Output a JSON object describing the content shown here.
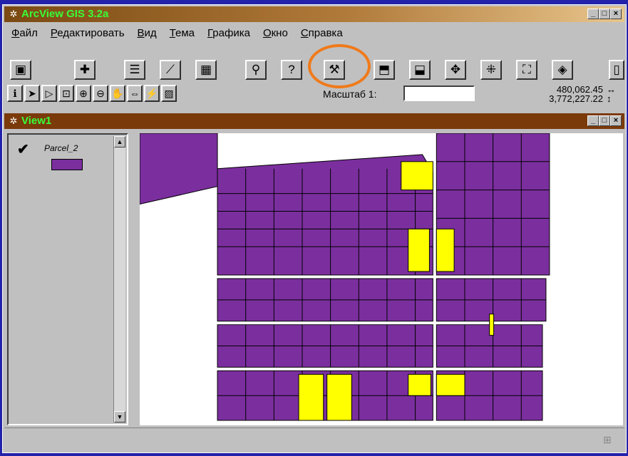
{
  "app": {
    "title": "ArcView GIS 3.2a",
    "window_controls": [
      "_",
      "□",
      "×"
    ]
  },
  "menu": [
    "Файл",
    "Редактировать",
    "Вид",
    "Тема",
    "Графика",
    "Окно",
    "Справка"
  ],
  "toolbar_icons": [
    "save-icon",
    "add-theme-icon",
    "properties-icon",
    "edit-legend-icon",
    "table-icon",
    "find-icon",
    "help-icon",
    "hotlink-icon",
    "select-feature-icon",
    "open-theme-table-icon",
    "zoom-full-icon",
    "zoom-active-icon",
    "zoom-in-fixed-icon",
    "zoom-out-fixed-icon",
    "zoom-previous-icon",
    "layout-icon"
  ],
  "tools": [
    "identify-icon",
    "pointer-icon",
    "vertex-edit-icon",
    "select-feature-tool-icon",
    "zoom-in-icon",
    "zoom-out-icon",
    "pan-icon",
    "measure-icon",
    "hotlink-tool-icon",
    "label-icon"
  ],
  "scale": {
    "label": "Масштаб 1:",
    "value": ""
  },
  "coords": {
    "x": "480,062.45",
    "y": "3,772,227.22"
  },
  "view": {
    "title": "View1",
    "controls": [
      "_",
      "□",
      "×"
    ]
  },
  "legend": {
    "theme_name": "Parcel_2",
    "checked": true,
    "fill_color": "#7b2f9e"
  },
  "colors": {
    "parcel": "#7b2f9e",
    "selected": "#ffff00",
    "highlight_ring": "#f07a1a"
  }
}
